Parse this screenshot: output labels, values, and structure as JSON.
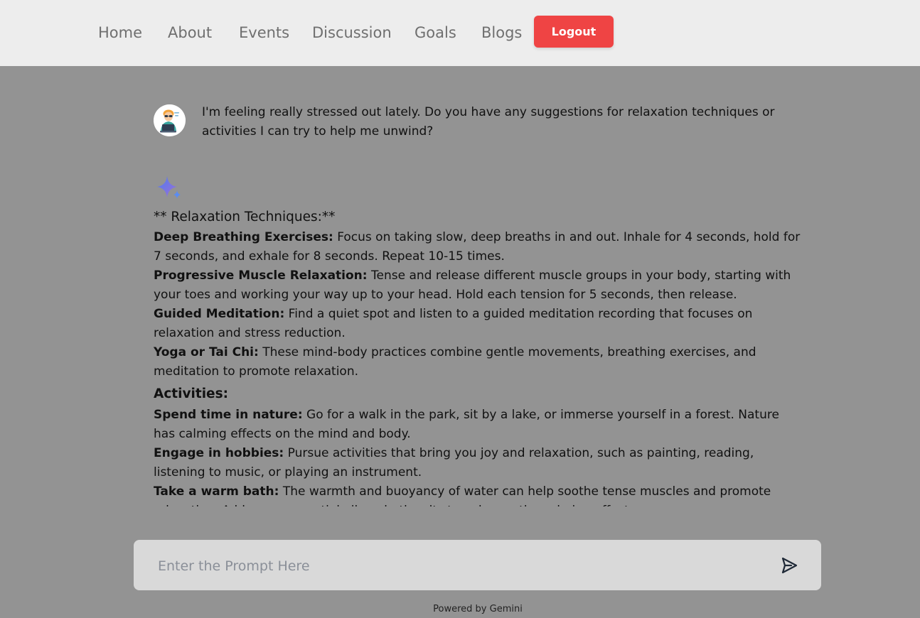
{
  "nav": {
    "links": [
      {
        "label": "Home"
      },
      {
        "label": "About"
      },
      {
        "label": "Events"
      },
      {
        "label": "Discussion"
      },
      {
        "label": "Goals"
      },
      {
        "label": "Blogs"
      }
    ],
    "logout_label": "Logout"
  },
  "chat": {
    "user_avatar_icon": "user-avatar-icon",
    "user_message": "I'm feeling really stressed out lately. Do you have any suggestions for relaxation techniques or activities I can try to help me unwind?",
    "assistant_icon": "gemini-sparkle-icon",
    "response": {
      "heading": "** Relaxation Techniques:**",
      "techniques": [
        {
          "title": "Deep Breathing Exercises:",
          "text": " Focus on taking slow, deep breaths in and out. Inhale for 4 seconds, hold for 7 seconds, and exhale for 8 seconds. Repeat 10-15 times."
        },
        {
          "title": "Progressive Muscle Relaxation:",
          "text": " Tense and release different muscle groups in your body, starting with your toes and working your way up to your head. Hold each tension for 5 seconds, then release."
        },
        {
          "title": "Guided Meditation:",
          "text": " Find a quiet spot and listen to a guided meditation recording that focuses on relaxation and stress reduction."
        },
        {
          "title": "Yoga or Tai Chi:",
          "text": " These mind-body practices combine gentle movements, breathing exercises, and meditation to promote relaxation."
        }
      ],
      "activities_heading": "Activities:",
      "activities": [
        {
          "title": "Spend time in nature:",
          "text": " Go for a walk in the park, sit by a lake, or immerse yourself in a forest. Nature has calming effects on the mind and body."
        },
        {
          "title": "Engage in hobbies:",
          "text": " Pursue activities that bring you joy and relaxation, such as painting, reading, listening to music, or playing an instrument."
        },
        {
          "title": "Take a warm bath:",
          "text": " The warmth and buoyancy of water can help soothe tense muscles and promote relaxation. Add some essential oils or bath salts to enhance the calming effects."
        }
      ]
    }
  },
  "prompt": {
    "placeholder": "Enter the Prompt Here",
    "send_icon": "send-icon"
  },
  "footer": {
    "powered_by": "Powered by Gemini"
  },
  "colors": {
    "navbar_bg": "#ededed",
    "page_bg": "#939393",
    "logout_bg": "#ef4444",
    "prompt_bg": "#d9d9d9"
  }
}
